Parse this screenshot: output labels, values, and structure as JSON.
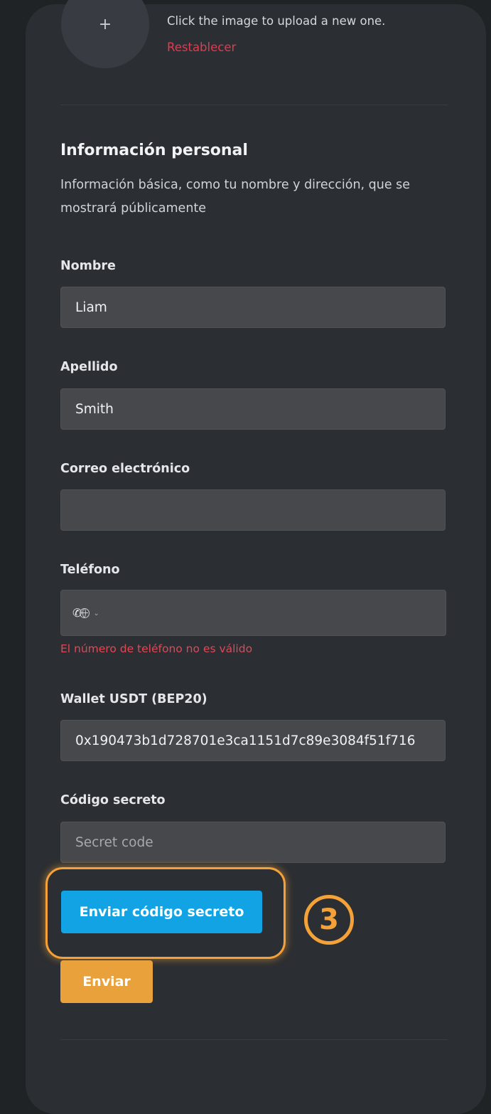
{
  "avatar": {
    "button_symbol": "+",
    "hint": "Click the image to upload a new one.",
    "reset_label": "Restablecer"
  },
  "personal_info": {
    "title": "Información personal",
    "description": "Información básica, como tu nombre y dirección, que se mostrará públicamente"
  },
  "fields": {
    "first_name": {
      "label": "Nombre",
      "value": "Liam"
    },
    "last_name": {
      "label": "Apellido",
      "value": "Smith"
    },
    "email": {
      "label": "Correo electrónico",
      "value": ""
    },
    "phone": {
      "label": "Teléfono",
      "value": "",
      "error": "El número de teléfono no es válido",
      "country_icons": [
        "phone-icon",
        "globe-icon",
        "chevron-down-icon"
      ]
    },
    "wallet": {
      "label": "Wallet USDT (BEP20)",
      "value": "0x190473b1d728701e3ca1151d7c89e3084f51f716"
    },
    "secret_code": {
      "label": "Código secreto",
      "value": "",
      "placeholder": "Secret code"
    }
  },
  "actions": {
    "send_code_label": "Enviar código secreto",
    "submit_label": "Enviar"
  },
  "annotation": {
    "step_number": "3",
    "color": "#f3a138"
  },
  "colors": {
    "page_background": "#202326",
    "card_background": "#2b2e32",
    "input_background": "#46484c",
    "reset_link": "#e23a4f",
    "error_text": "#e04856",
    "primary_button": "#11a3e3",
    "submit_button": "#e9a23b"
  }
}
